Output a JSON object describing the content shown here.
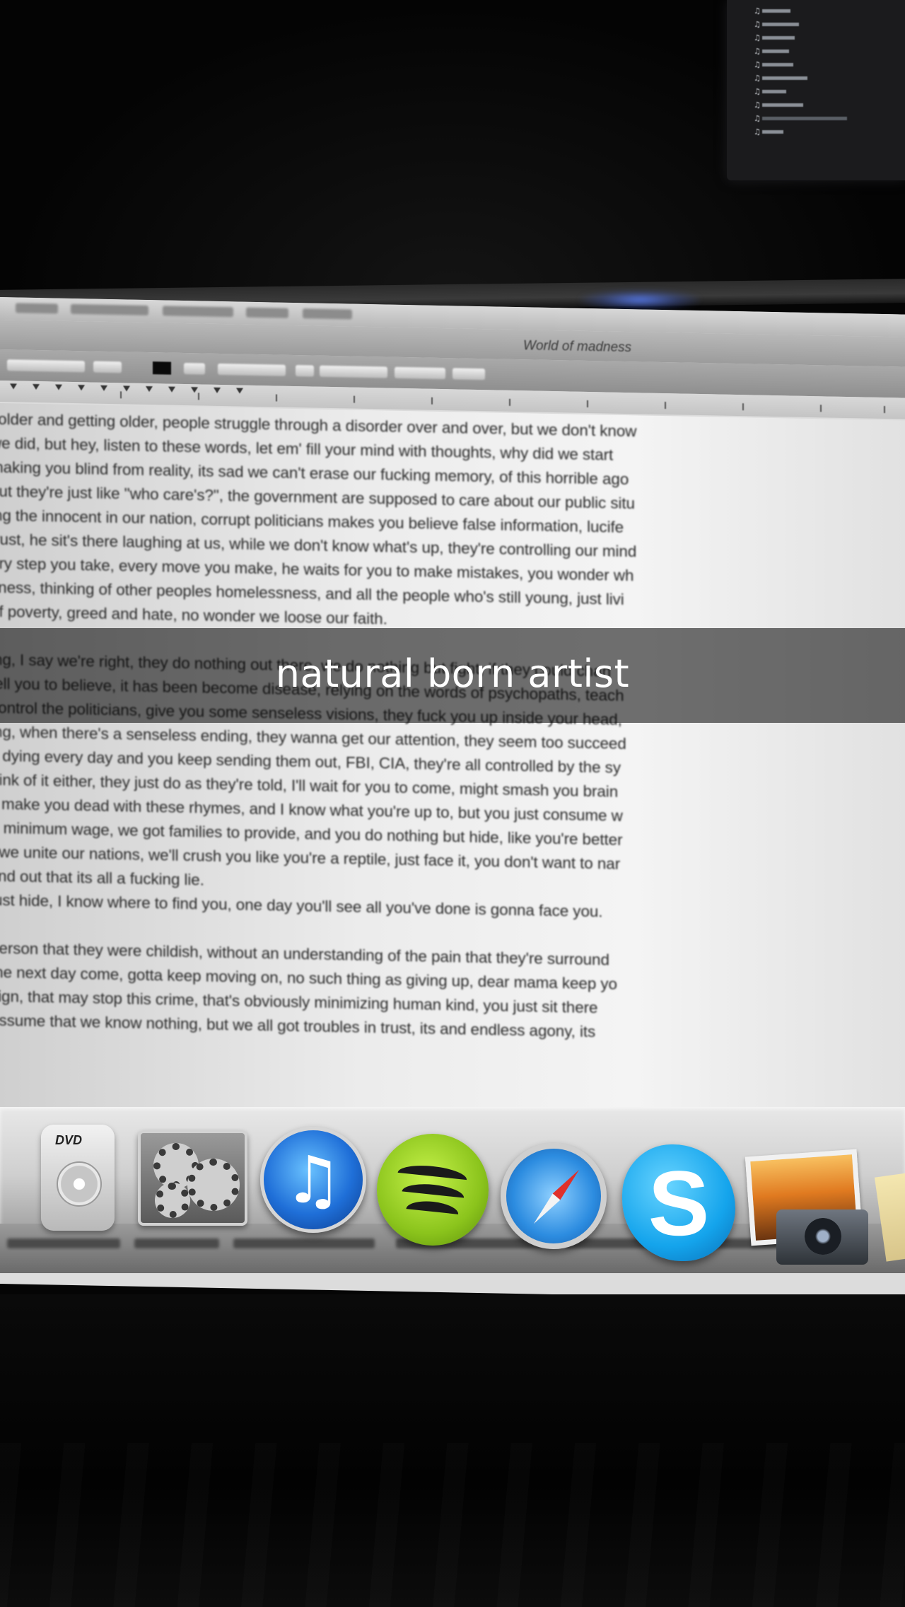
{
  "caption": "natural born artist",
  "document": {
    "title": "World of madness",
    "lines": [
      "colder and getting older, people struggle through a disorder over and over, but we don't know",
      "we did, but hey, listen to these words, let em' fill your mind with thoughts, why did we start",
      "making you blind from reality, its sad we can't erase our fucking memory, of this horrible ago",
      "but they're just like \"who care's?\", the government are supposed to care about our public situ",
      "ing the innocent in our nation, corrupt politicians makes you believe false information, lucife",
      "trust, he sit's there laughing at us, while we don't know what's up, they're controlling our mind",
      "ery step you take, every move you make, he waits for you to make mistakes, you wonder wh",
      "sness, thinking of other peoples homelessness, and all the people who's still young, just livi",
      "of poverty, greed and hate, no wonder we loose our faith.",
      "",
      "ing, I say we're right, they do nothing out there, we do nothing but fight, if they could chan",
      "tell you to believe, it has been become disease, relying on the words of psychopaths, teach",
      "control the politicians, give you some senseless visions, they fuck you up inside your head,",
      "ing, when there's a senseless ending, they wanna get our attention, they seem too succeed",
      "s dying every day and you keep sending them out, FBI, CIA, they're all controlled by the sy",
      "hink of it either, they just do as they're told, I'll wait for you to come, might smash you brain",
      "ll make you dead with these rhymes, and I know what you're up to, but you just consume w",
      "e minimum wage, we got families to provide, and you do nothing but hide, like you're better",
      "f we unite our nations, we'll crush you like you're a reptile, just face it, you don't want to nar",
      "find out that its all a fucking lie.",
      "just hide, I know where to find you, one day you'll see all you've done is gonna face you.",
      "",
      "person that they were childish, without an understanding of the pain that they're surround",
      "the next day come, gotta keep moving on, no such thing as giving up, dear mama keep yo",
      "sign, that may stop this crime, that's obviously minimizing human kind, you just sit there",
      "assume that we know nothing, but we all got troubles in trust, its and endless agony, its"
    ]
  },
  "dock": {
    "dvd_label": "DVD",
    "apps": [
      "dvd-player",
      "system-preferences",
      "itunes",
      "spotify",
      "safari",
      "skype",
      "iphoto"
    ]
  }
}
